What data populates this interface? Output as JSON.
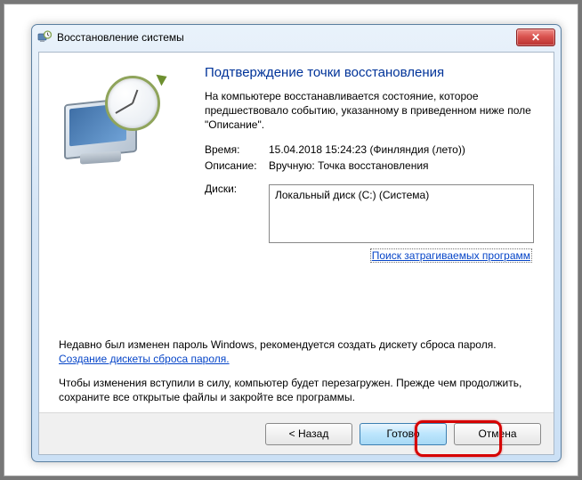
{
  "window": {
    "title": "Восстановление системы",
    "close_glyph": "✕"
  },
  "main": {
    "headline": "Подтверждение точки восстановления",
    "intro": "На компьютере восстанавливается состояние, которое предшествовало событию, указанному в приведенном ниже поле \"Описание\".",
    "fields": {
      "time_label": "Время:",
      "time_value": "15.04.2018 15:24:23 (Финляндия (лето))",
      "desc_label": "Описание:",
      "desc_value": "Вручную: Точка восстановления",
      "disks_label": "Диски:",
      "disks_value": "Локальный диск (C:) (Система)"
    },
    "scan_link": "Поиск затрагиваемых программ",
    "password_para_pre": "Недавно был изменен пароль Windows, рекомендуется создать дискету сброса пароля. ",
    "password_link": "Создание дискеты сброса пароля.",
    "restart_para": "Чтобы изменения вступили в силу, компьютер будет перезагружен. Прежде чем продолжить, сохраните все открытые файлы и закройте все программы."
  },
  "buttons": {
    "back": "< Назад",
    "finish": "Готово",
    "cancel": "Отмена"
  }
}
